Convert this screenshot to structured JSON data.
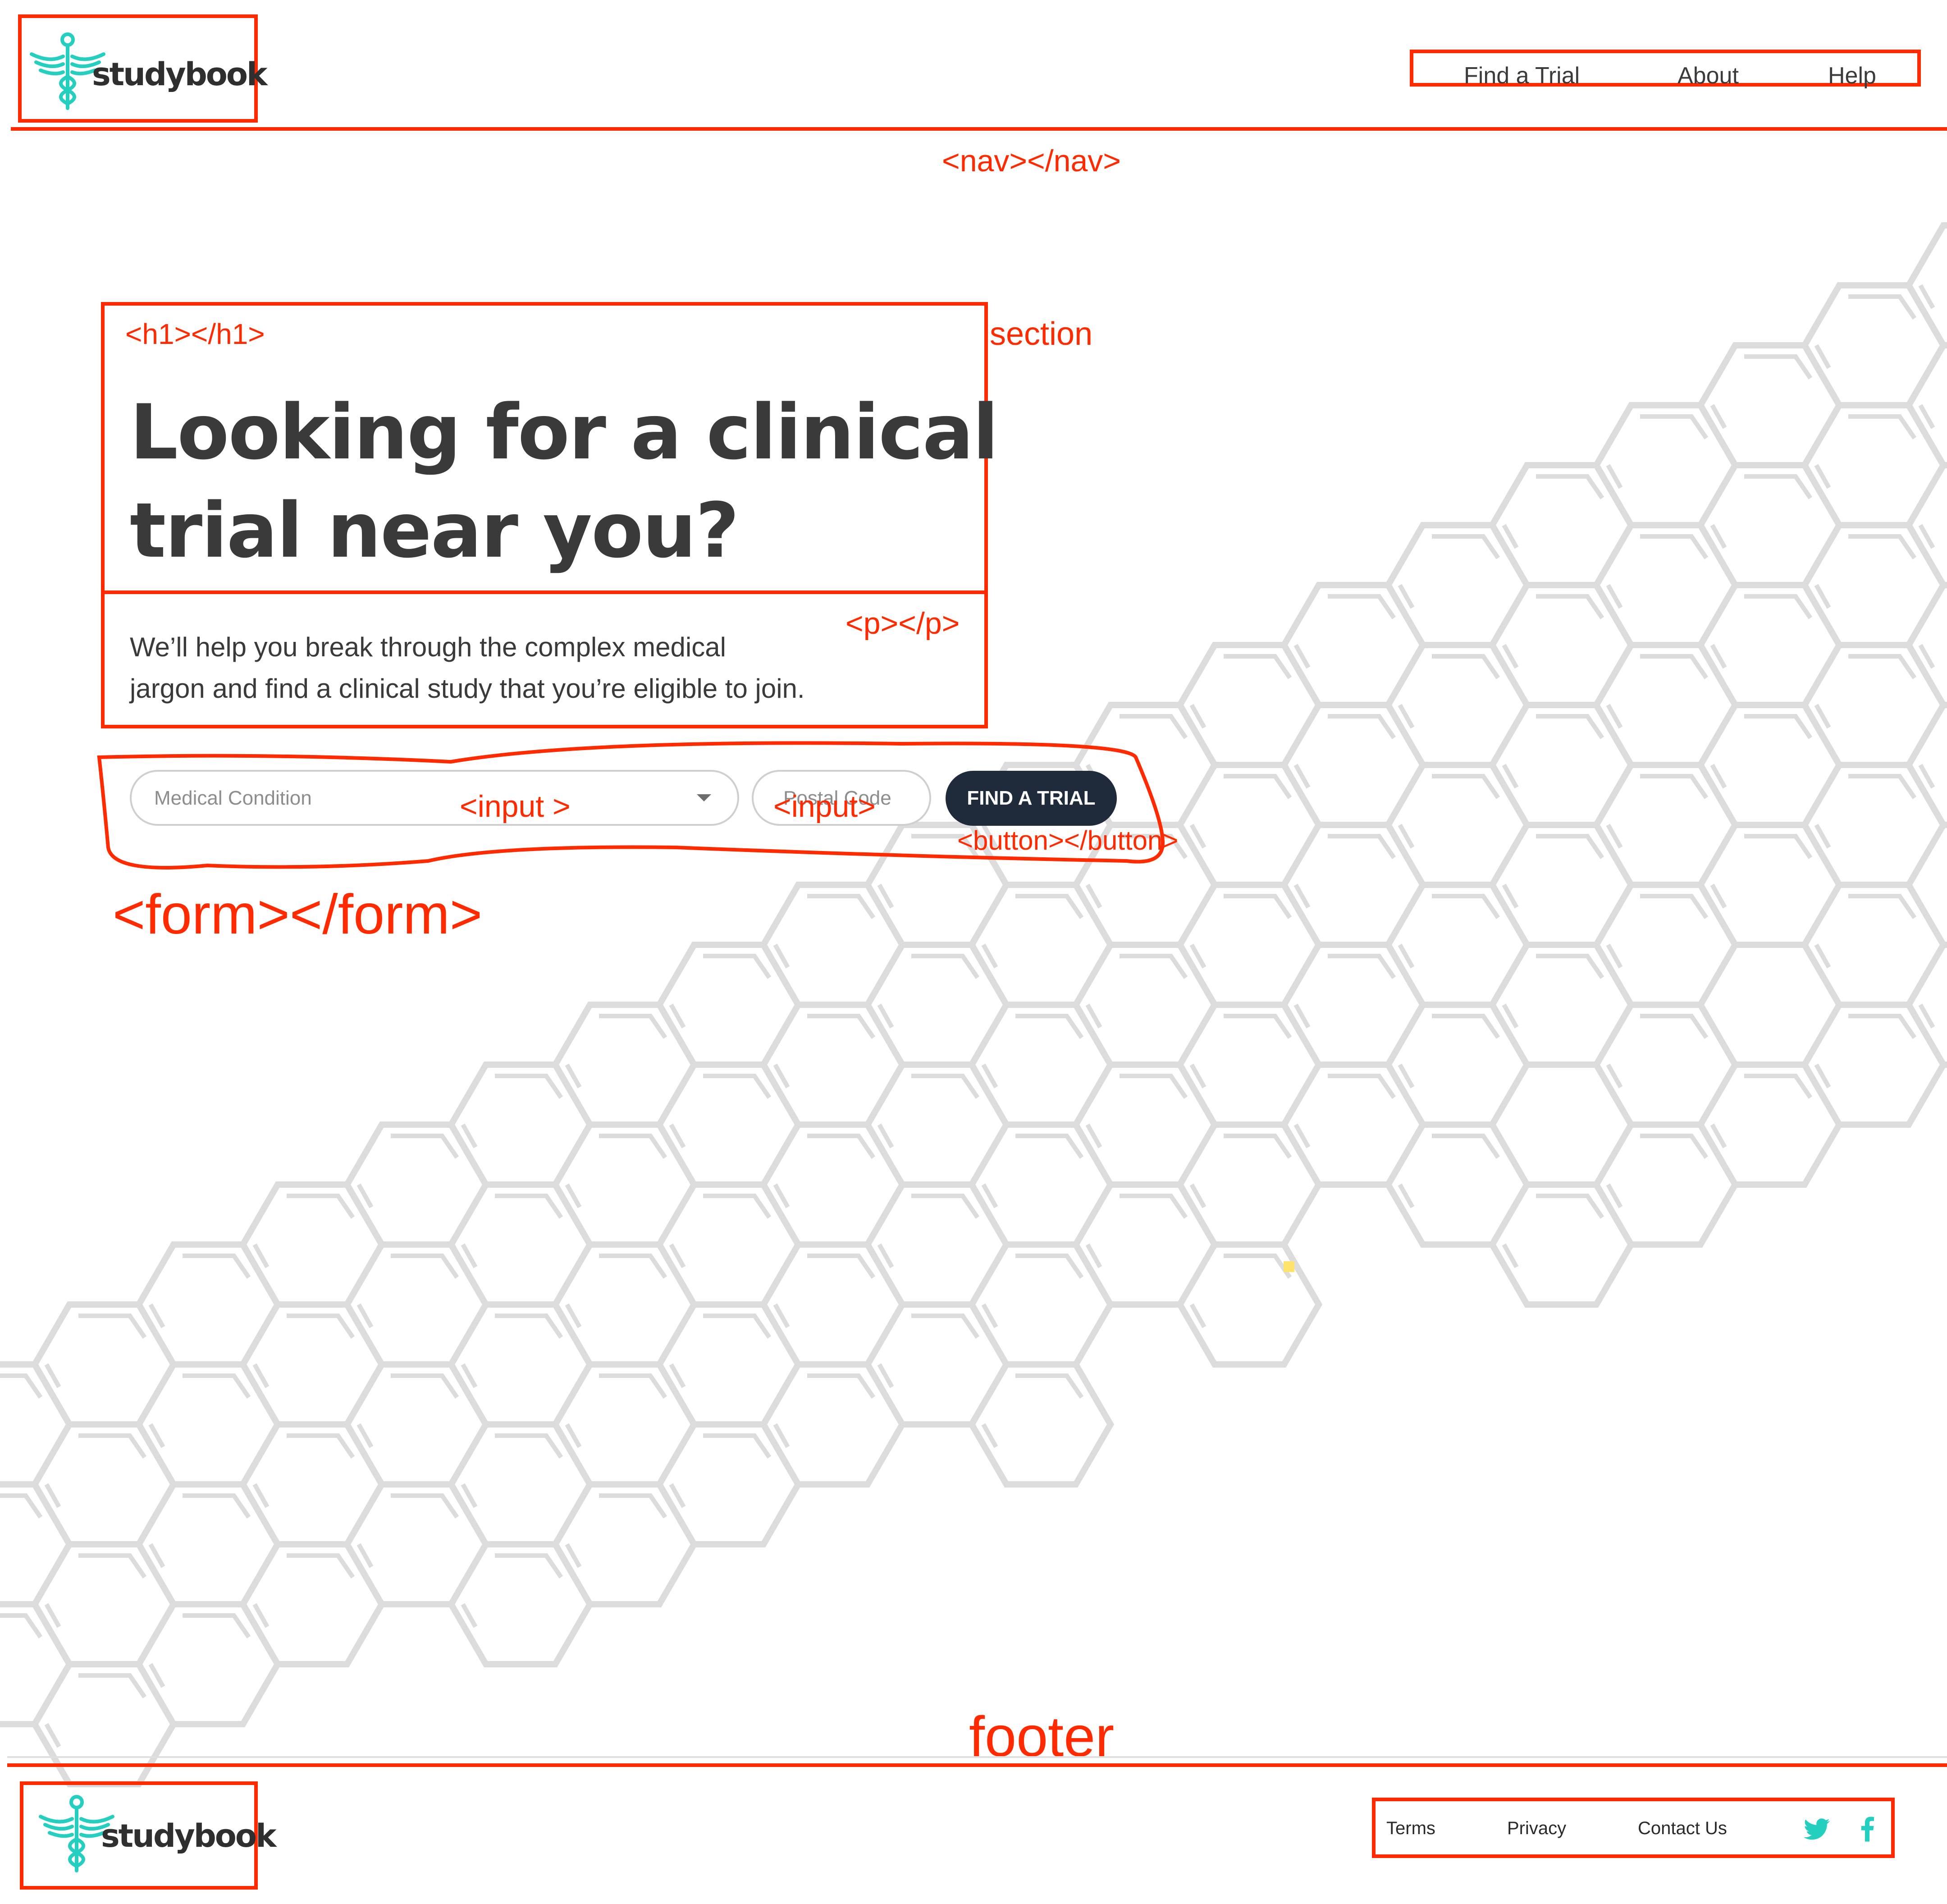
{
  "brand": {
    "name": "studybook",
    "accent": "#25cfc0"
  },
  "nav": {
    "links": [
      "Find a Trial",
      "About",
      "Help"
    ],
    "annotation": "<nav></nav>"
  },
  "hero": {
    "h1_annotation": "<h1></h1>",
    "section_annotation": "section",
    "title_line1": "Looking for a clinical",
    "title_line2": "trial near you?",
    "p_annotation": "<p></p>",
    "description_line1": "We’ll help you break through the complex medical",
    "description_line2": "jargon and find a clinical study that you’re eligible to join."
  },
  "form": {
    "condition_placeholder": "Medical Condition",
    "postal_placeholder": "Postal Code",
    "button_label": "FIND A TRIAL",
    "input_annotation_1": "<input >",
    "input_annotation_2": "<input>",
    "button_annotation": "<button></button>",
    "form_annotation": "<form></form>"
  },
  "footer": {
    "annotation": "footer",
    "links": [
      "Terms",
      "Privacy",
      "Contact Us"
    ],
    "social": [
      "twitter-icon",
      "facebook-icon"
    ]
  },
  "colors": {
    "annotation_red": "#ff2a00",
    "button_navy": "#1f2b3a",
    "hex_grey": "#dcdcdc"
  }
}
